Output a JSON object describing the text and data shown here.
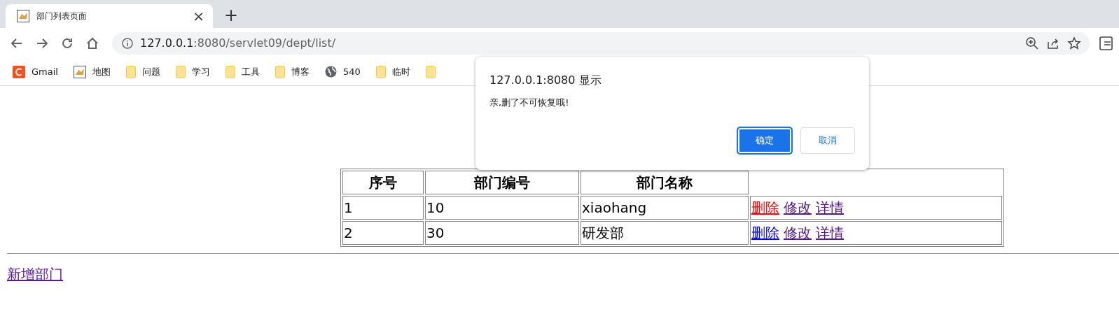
{
  "tab": {
    "title": "部门列表页面",
    "close": "×",
    "new_tab": "+"
  },
  "address_bar": {
    "host": "127.0.0.1",
    "rest": ":8080/servlet09/dept/list/"
  },
  "bookmarks": [
    {
      "kind": "gmail",
      "label": "Gmail"
    },
    {
      "kind": "image",
      "label": "地图"
    },
    {
      "kind": "folder",
      "label": "问题"
    },
    {
      "kind": "folder",
      "label": "学习"
    },
    {
      "kind": "folder",
      "label": "工具"
    },
    {
      "kind": "folder",
      "label": "博客"
    },
    {
      "kind": "globe",
      "label": "540"
    },
    {
      "kind": "folder",
      "label": "临时"
    },
    {
      "kind": "folder"
    }
  ],
  "dialog": {
    "title": "127.0.0.1:8080 显示",
    "message": "亲,删了不可恢复哦!",
    "buttons": [
      {
        "label": "确定",
        "primary": true
      },
      {
        "label": "取消",
        "primary": false
      }
    ]
  },
  "table": {
    "columns": [
      "序号",
      "部门编号",
      "部门名称"
    ],
    "rows": [
      {
        "cells": [
          "1",
          "10",
          "xiaohang"
        ],
        "links": [
          {
            "label": "删除",
            "visited": false,
            "active": true
          },
          {
            "label": "修改",
            "visited": true,
            "active": false
          },
          {
            "label": "详情",
            "visited": true,
            "active": false
          }
        ]
      },
      {
        "cells": [
          "2",
          "30",
          "研发部"
        ],
        "links": [
          {
            "label": "删除",
            "visited": false,
            "active": false
          },
          {
            "label": "修改",
            "visited": true,
            "active": false
          },
          {
            "label": "详情",
            "visited": true,
            "active": false
          }
        ]
      }
    ]
  },
  "add_link": {
    "label": "新增部门",
    "visited": true,
    "active": false
  }
}
